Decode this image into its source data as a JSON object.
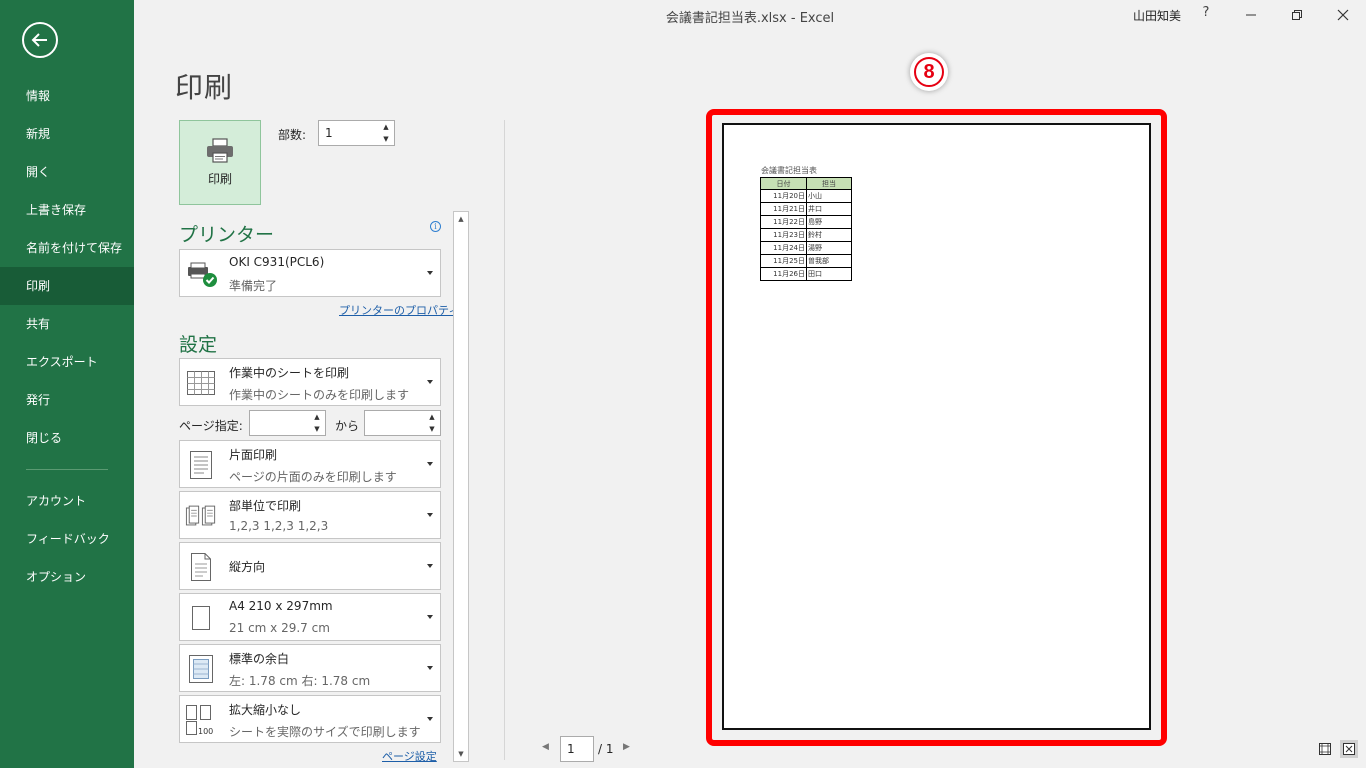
{
  "window": {
    "title": "会議書記担当表.xlsx  -  Excel",
    "user": "山田知美",
    "help": "?"
  },
  "sidebar": {
    "items": [
      {
        "label": "情報"
      },
      {
        "label": "新規"
      },
      {
        "label": "開く"
      },
      {
        "label": "上書き保存"
      },
      {
        "label": "名前を付けて保存"
      },
      {
        "label": "印刷"
      },
      {
        "label": "共有"
      },
      {
        "label": "エクスポート"
      },
      {
        "label": "発行"
      },
      {
        "label": "閉じる"
      }
    ],
    "bottom_items": [
      {
        "label": "アカウント"
      },
      {
        "label": "フィードバック"
      },
      {
        "label": "オプション"
      }
    ]
  },
  "main": {
    "title": "印刷",
    "print_button_label": "印刷",
    "copies_label": "部数:",
    "copies_value": "1",
    "printer_heading": "プリンター",
    "printer": {
      "name": "OKI C931(PCL6)",
      "status": "準備完了"
    },
    "printer_properties_link": "プリンターのプロパティ",
    "settings_heading": "設定",
    "settings": [
      {
        "title": "作業中のシートを印刷",
        "subtitle": "作業中のシートのみを印刷します"
      },
      {
        "title": "片面印刷",
        "subtitle": "ページの片面のみを印刷します"
      },
      {
        "title": "部単位で印刷",
        "subtitle": "1,2,3    1,2,3    1,2,3"
      },
      {
        "title": "縦方向",
        "subtitle": ""
      },
      {
        "title": "A4 210 x 297mm",
        "subtitle": "21 cm x 29.7 cm"
      },
      {
        "title": "標準の余白",
        "subtitle": "左:  1.78 cm     右:  1.78 cm"
      },
      {
        "title": "拡大縮小なし",
        "subtitle": "シートを実際のサイズで印刷します"
      }
    ],
    "pages_label": "ページ指定:",
    "pages_from": "",
    "to_label": "から",
    "pages_to": "",
    "page_setup_link": "ページ設定"
  },
  "preview": {
    "step_badge": "8",
    "sheet_title": "会議書記担当表",
    "table": {
      "headers": [
        "日付",
        "担当"
      ],
      "rows": [
        [
          "11月20日",
          "小山"
        ],
        [
          "11月21日",
          "井口"
        ],
        [
          "11月22日",
          "島野"
        ],
        [
          "11月23日",
          "鈴村"
        ],
        [
          "11月24日",
          "湯野"
        ],
        [
          "11月25日",
          "曽我部"
        ],
        [
          "11月26日",
          "田口"
        ]
      ]
    },
    "page_current": "1",
    "page_total": "/ 1"
  },
  "colors": {
    "sidebar": "#217346",
    "sidebar_active": "#185c37",
    "highlight_frame": "#ff0000",
    "header_cell": "#c6e0b4"
  }
}
